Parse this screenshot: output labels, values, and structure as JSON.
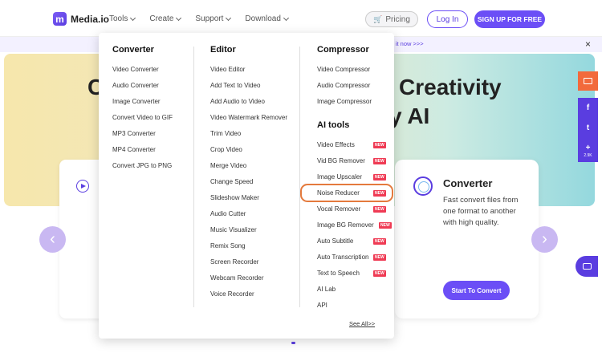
{
  "header": {
    "logo_text": "Media.io",
    "logo_mark": "m",
    "nav": [
      "Tools",
      "Create",
      "Support",
      "Download"
    ],
    "pricing": "Pricing",
    "login": "Log In",
    "signup": "SIGN UP FOR FREE"
  },
  "notice": {
    "text": "y it now >>>",
    "close": "×"
  },
  "hero": {
    "title_line1": "Creativity",
    "title_line2": "y AI",
    "title_fragment_left": "C"
  },
  "converter_card": {
    "title": "Converter",
    "description": "Fast convert files from one format to another with high quality.",
    "button": "Start To Convert"
  },
  "side": {
    "share_count": "2.9K",
    "facebook": "f",
    "twitter": "t",
    "plus": "+"
  },
  "arrows": {
    "left": "‹",
    "right": "›"
  },
  "menu": {
    "converter": {
      "title": "Converter",
      "items": [
        "Video Converter",
        "Audio Converter",
        "Image Converter",
        "Convert Video to GIF",
        "MP3 Converter",
        "MP4 Converter",
        "Convert JPG to PNG"
      ]
    },
    "editor": {
      "title": "Editor",
      "items": [
        "Video Editor",
        "Add Text to Video",
        "Add Audio to Video",
        "Video Watermark Remover",
        "Trim Video",
        "Crop Video",
        "Merge Video",
        "Change Speed",
        "Slideshow Maker",
        "Audio Cutter",
        "Music Visualizer",
        "Remix Song",
        "Screen Recorder",
        "Webcam Recorder",
        "Voice Recorder"
      ]
    },
    "compressor": {
      "title": "Compressor",
      "items": [
        "Video Compressor",
        "Audio Compressor",
        "Image Compressor"
      ]
    },
    "ai_tools": {
      "title": "AI tools",
      "badge": "NEW",
      "items": [
        {
          "label": "Video Effects",
          "new": true
        },
        {
          "label": "Vid BG Remover",
          "new": true
        },
        {
          "label": "Image Upscaler",
          "new": true
        },
        {
          "label": "Noise Reducer",
          "new": true
        },
        {
          "label": "Vocal Remover",
          "new": true
        },
        {
          "label": "Image BG Remover",
          "new": true
        },
        {
          "label": "Auto Subtitle",
          "new": true
        },
        {
          "label": "Auto Transcription",
          "new": true
        },
        {
          "label": "Text to Speech",
          "new": true
        },
        {
          "label": "AI Lab",
          "new": false
        },
        {
          "label": "API",
          "new": false
        }
      ]
    },
    "see_all": "See All>>"
  },
  "colors": {
    "brand": "#6b4ef6",
    "badge": "#ef3b54",
    "highlight": "#e47a3d"
  }
}
